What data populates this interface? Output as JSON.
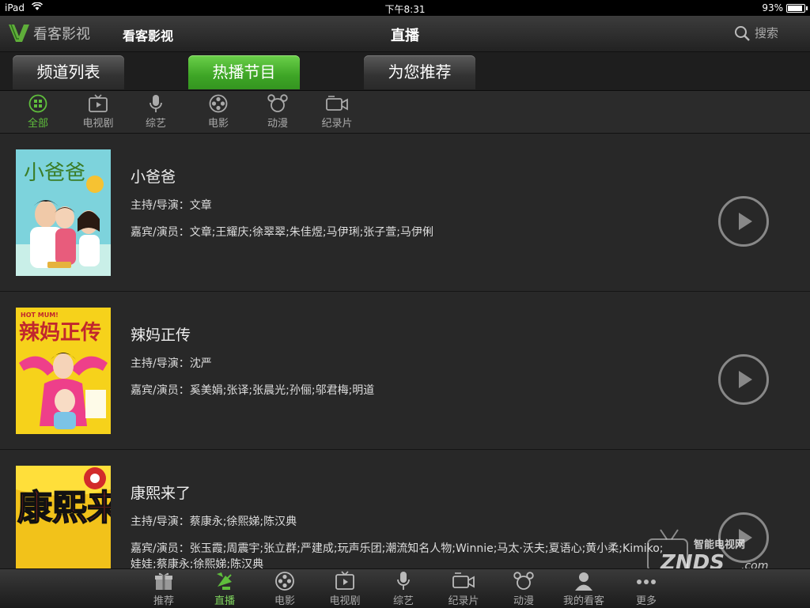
{
  "status_bar": {
    "device": "iPad",
    "time": "下午8:31",
    "battery": "93%"
  },
  "nav": {
    "logo_text": "看客影视",
    "app_title": "看客影视",
    "page_title": "直播",
    "search_label": "搜索"
  },
  "tabs": [
    {
      "label": "频道列表",
      "active": false
    },
    {
      "label": "热播节目",
      "active": true
    },
    {
      "label": "为您推荐",
      "active": false
    }
  ],
  "categories": [
    {
      "label": "全部",
      "icon": "grid-icon",
      "active": true
    },
    {
      "label": "电视剧",
      "icon": "tv-icon"
    },
    {
      "label": "综艺",
      "icon": "microphone-icon"
    },
    {
      "label": "电影",
      "icon": "film-reel-icon"
    },
    {
      "label": "动漫",
      "icon": "cartoon-icon"
    },
    {
      "label": "纪录片",
      "icon": "video-camera-icon"
    }
  ],
  "programs": [
    {
      "title": "小爸爸",
      "host_label": "主持/导演：",
      "host": "文章",
      "guest_label": "嘉宾/演员：",
      "guests": "文章;王耀庆;徐翠翠;朱佳煜;马伊琍;张子萱;马伊俐",
      "poster_text": "小爸爸"
    },
    {
      "title": "辣妈正传",
      "host_label": "主持/导演：",
      "host": "沈严",
      "guest_label": "嘉宾/演员：",
      "guests": "奚美娟;张译;张晨光;孙俪;邬君梅;明道",
      "poster_text": "辣妈正传"
    },
    {
      "title": "康熙来了",
      "host_label": "主持/导演：",
      "host": "蔡康永;徐熙娣;陈汉典",
      "guest_label": "嘉宾/演员：",
      "guests": "张玉霞;周震宇;张立群;严建成;玩声乐团;潮流知名人物;Winnie;马太·沃夫;夏语心;黄小柔;Kimiko;娃娃;蔡康永;徐熙娣;陈汉典",
      "poster_text": "康熙来了"
    }
  ],
  "bottom_tabs": [
    {
      "label": "推荐",
      "icon": "gift-icon"
    },
    {
      "label": "直播",
      "icon": "satellite-icon",
      "active": true
    },
    {
      "label": "电影",
      "icon": "film-reel-icon"
    },
    {
      "label": "电视剧",
      "icon": "tv-icon"
    },
    {
      "label": "综艺",
      "icon": "microphone-icon"
    },
    {
      "label": "纪录片",
      "icon": "video-camera-icon"
    },
    {
      "label": "动漫",
      "icon": "cartoon-icon"
    },
    {
      "label": "我的看客",
      "icon": "user-icon"
    },
    {
      "label": "更多",
      "icon": "more-icon"
    }
  ],
  "watermark": {
    "line1": "智能电视网",
    "line2": "ZNDS",
    "line3": ".com"
  },
  "colors": {
    "accent_green": "#3ea526",
    "background": "#262626"
  }
}
